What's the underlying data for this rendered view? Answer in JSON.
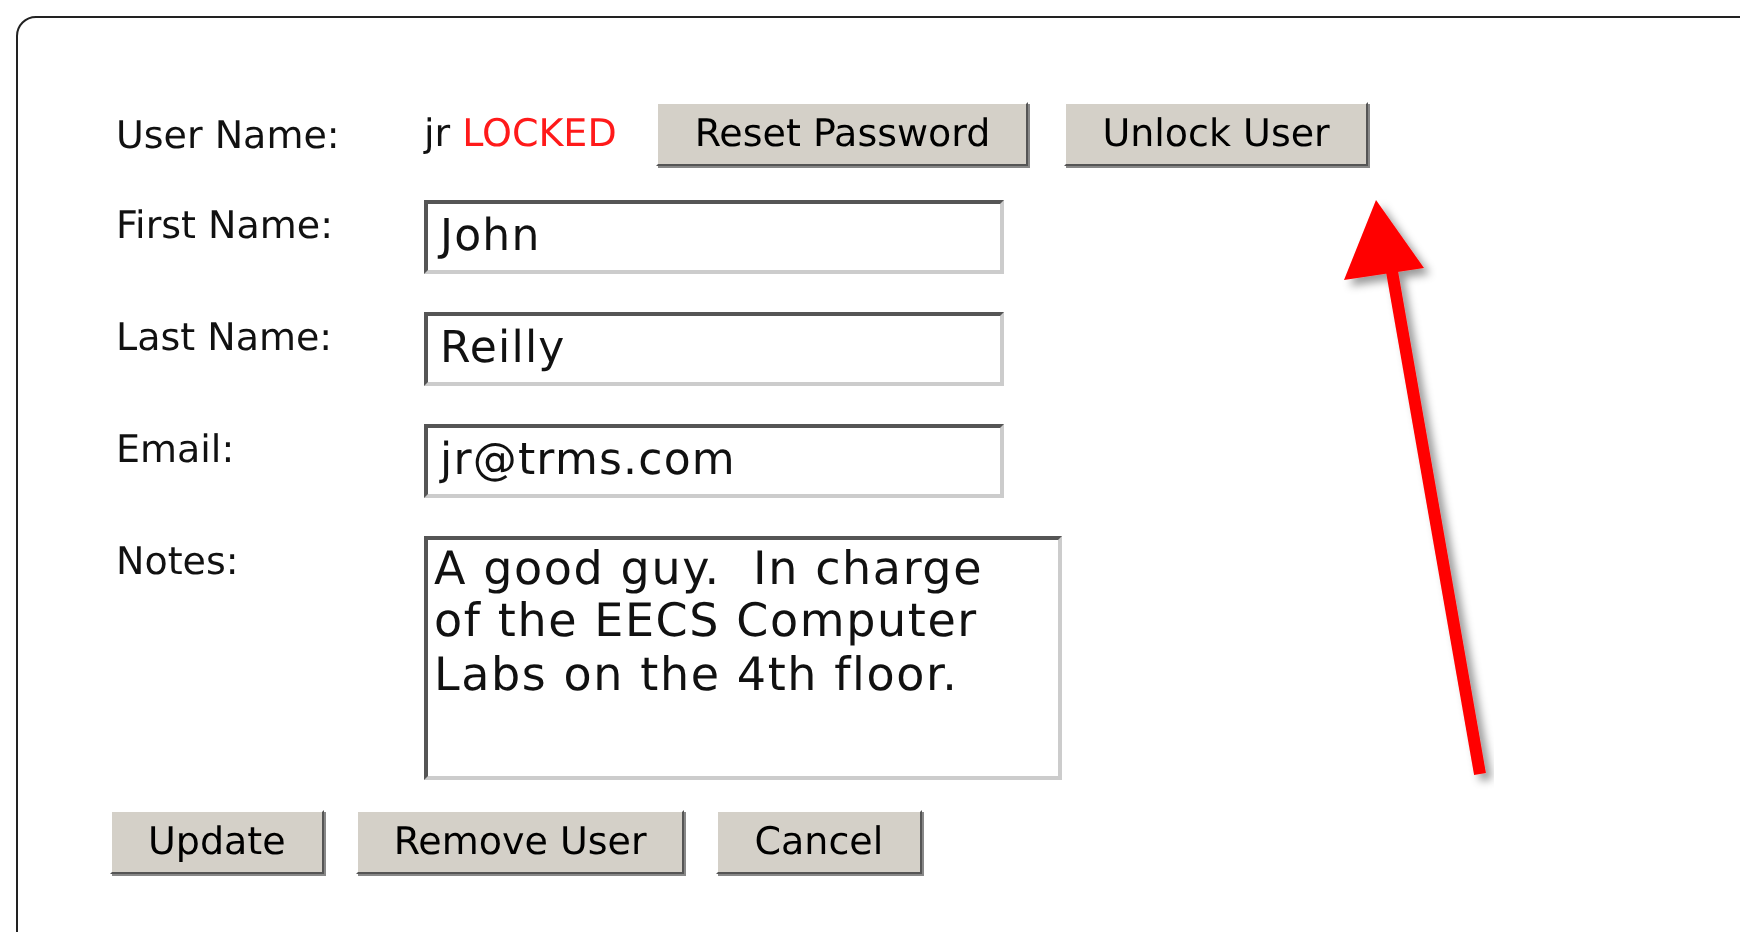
{
  "user": {
    "label": "User Name:",
    "value": "jr",
    "status": "LOCKED",
    "locked": true
  },
  "top_buttons": [
    "Reset Password",
    "Unlock User"
  ],
  "fields": [
    {
      "label": "First Name:",
      "value": "John",
      "kind": "text"
    },
    {
      "label": "Last Name:",
      "value": "Reilly",
      "kind": "text"
    },
    {
      "label": "Email:",
      "value": "jr@trms.com",
      "kind": "text"
    },
    {
      "label": "Notes:",
      "value": "A good guy.  In charge of the EECS Computer Labs on the 4th floor.",
      "kind": "textarea"
    }
  ],
  "bottom_buttons": [
    "Update",
    "Remove User",
    "Cancel"
  ]
}
